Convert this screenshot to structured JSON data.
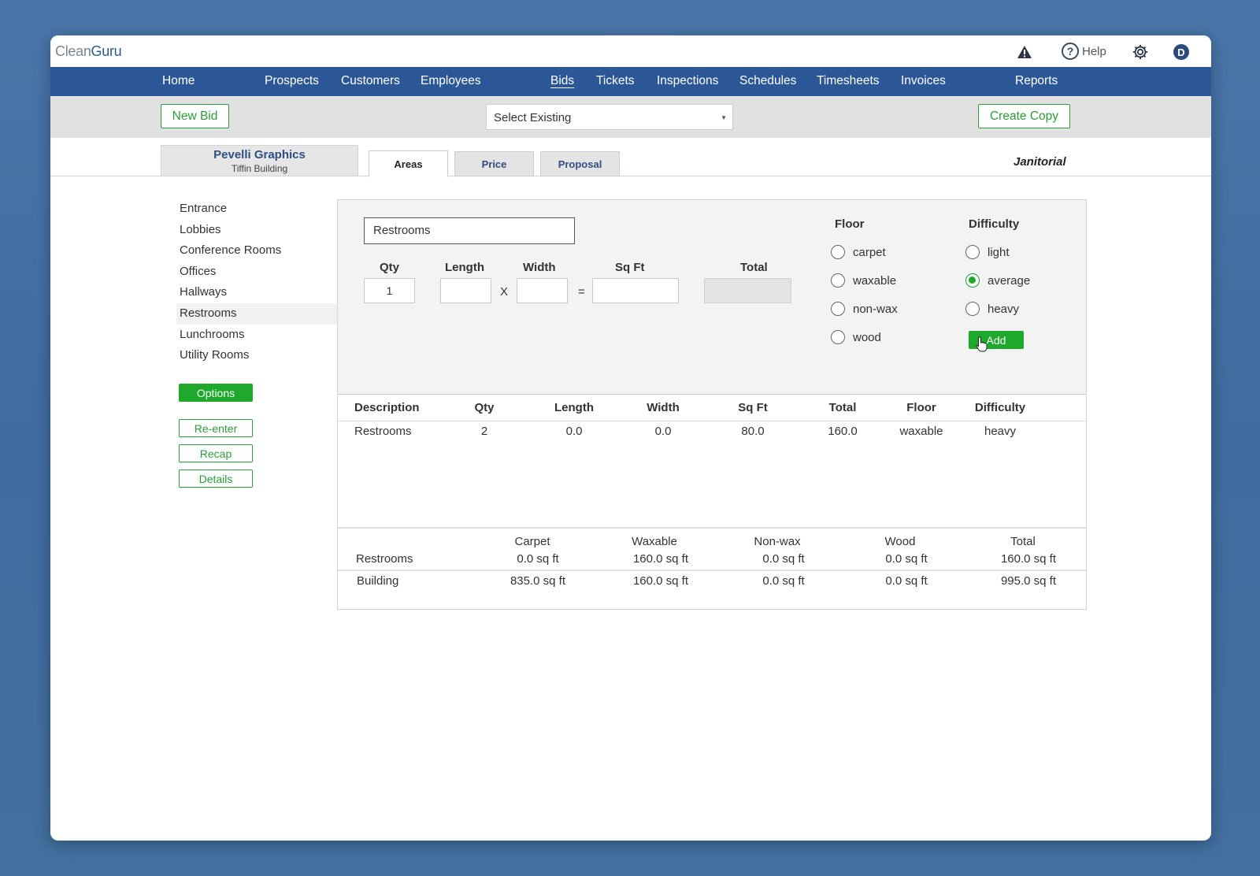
{
  "app": {
    "logo_prefix": "Clean",
    "logo_brand": "Guru",
    "help_label": "Help",
    "help_glyph": "?",
    "user_initial": "D"
  },
  "nav": {
    "items": [
      "Home",
      "Prospects",
      "Customers",
      "Employees",
      "Bids",
      "Tickets",
      "Inspections",
      "Schedules",
      "Timesheets",
      "Invoices",
      "Reports"
    ],
    "active": "Bids"
  },
  "toolbar": {
    "new_bid_label": "New Bid",
    "select_value": "Select Existing",
    "create_copy_label": "Create Copy"
  },
  "client": {
    "name": "Pevelli Graphics",
    "building": "Tiffin Building"
  },
  "tabs": [
    "Areas",
    "Price",
    "Proposal"
  ],
  "active_tab": "Areas",
  "service_type": "Janitorial",
  "areas": [
    "Entrance",
    "Lobbies",
    "Conference Rooms",
    "Offices",
    "Hallways",
    "Restrooms",
    "Lunchrooms",
    "Utility Rooms"
  ],
  "selected_area": "Restrooms",
  "side_buttons": {
    "options": "Options",
    "reenter": "Re-enter",
    "recap": "Recap",
    "details": "Details"
  },
  "form": {
    "area_name": "Restrooms",
    "labels": {
      "qty": "Qty",
      "length": "Length",
      "width": "Width",
      "sqft": "Sq Ft",
      "total": "Total"
    },
    "qty_value": "1",
    "length_value": "",
    "width_value": "",
    "sqft_value": "",
    "total_value": "",
    "times_symbol": "X",
    "equals_symbol": "=",
    "floor_label": "Floor",
    "floor_options": [
      "carpet",
      "waxable",
      "non-wax",
      "wood"
    ],
    "floor_selected": null,
    "difficulty_label": "Difficulty",
    "difficulty_options": [
      "light",
      "average",
      "heavy"
    ],
    "difficulty_selected": "average",
    "add_label": "Add"
  },
  "table": {
    "headers": [
      "Description",
      "Qty",
      "Length",
      "Width",
      "Sq Ft",
      "Total",
      "Floor",
      "Difficulty"
    ],
    "rows": [
      [
        "Restrooms",
        "2",
        "0.0",
        "0.0",
        "80.0",
        "160.0",
        "waxable",
        "heavy"
      ]
    ]
  },
  "summary": {
    "headers": [
      "Carpet",
      "Waxable",
      "Non-wax",
      "Wood",
      "Total"
    ],
    "rows": [
      {
        "label": "Restrooms",
        "values": [
          "0.0 sq ft",
          "160.0 sq ft",
          "0.0 sq ft",
          "0.0 sq ft",
          "160.0 sq ft"
        ]
      },
      {
        "label": "Building",
        "values": [
          "835.0 sq ft",
          "160.0 sq ft",
          "0.0 sq ft",
          "0.0 sq ft",
          "995.0 sq ft"
        ]
      }
    ]
  },
  "colors": {
    "nav_bg": "#2c5796",
    "accent_green": "#1ea82c",
    "outline_green": "#2e9a3a",
    "client_blue": "#2e4f83"
  },
  "icons": [
    "warning-icon",
    "help-icon",
    "gear-icon",
    "avatar",
    "dropdown-caret-icon",
    "pointer-cursor-icon"
  ]
}
